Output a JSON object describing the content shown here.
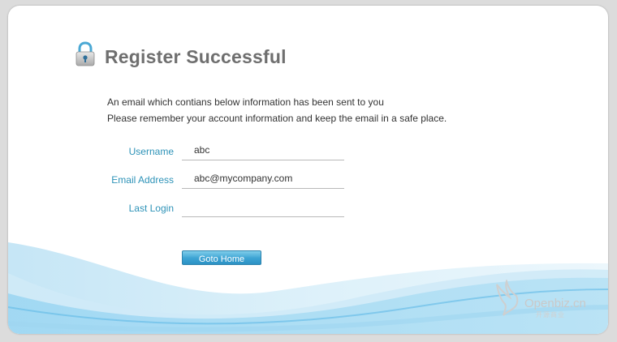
{
  "page": {
    "title": "Register Successful",
    "message_line1": "An email which contians below information has been sent to you",
    "message_line2": "Please remember your account information and keep the email in a safe place."
  },
  "fields": [
    {
      "label": "Username",
      "value": "abc"
    },
    {
      "label": "Email Address",
      "value": "abc@mycompany.com"
    },
    {
      "label": "Last Login",
      "value": ""
    }
  ],
  "actions": {
    "goto_home_label": "Goto Home"
  },
  "logo": {
    "text": "Openbiz.cn",
    "subtext": "开源商业"
  },
  "colors": {
    "accent": "#2e93b8",
    "button": "#3ba3d3",
    "wave": "#8fd0ee"
  },
  "icons": [
    "lock-icon",
    "bird-icon"
  ]
}
